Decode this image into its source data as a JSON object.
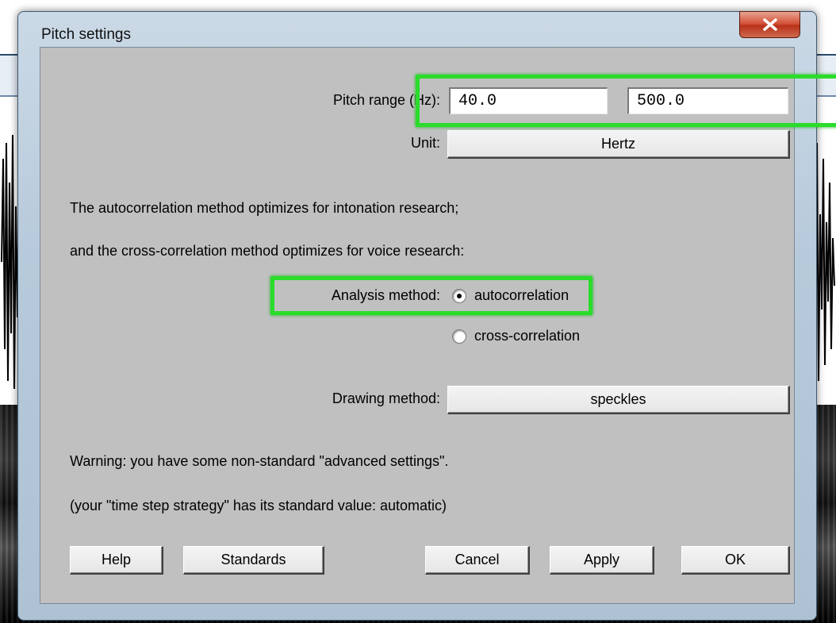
{
  "dialog": {
    "title": "Pitch settings",
    "close_icon": "close-icon"
  },
  "pitch_range": {
    "label": "Pitch range (Hz):",
    "min_value": "40.0",
    "max_value": "500.0"
  },
  "unit": {
    "label": "Unit:",
    "value": "Hertz"
  },
  "info": {
    "line1": "The autocorrelation method optimizes for intonation research;",
    "line2": "and the cross-correlation method optimizes for voice research:"
  },
  "analysis_method": {
    "label": "Analysis method:",
    "options": [
      "autocorrelation",
      "cross-correlation"
    ],
    "selected": "autocorrelation"
  },
  "drawing_method": {
    "label": "Drawing method:",
    "value": "speckles"
  },
  "warnings": {
    "line1": "Warning: you have some non-standard \"advanced settings\".",
    "line2": "(your \"time step strategy\" has its standard value: automatic)"
  },
  "buttons": {
    "help": "Help",
    "standards": "Standards",
    "cancel": "Cancel",
    "apply": "Apply",
    "ok": "OK"
  },
  "colors": {
    "highlight": "#2bdc2b",
    "dialog_bg": "#c0c0c0"
  }
}
